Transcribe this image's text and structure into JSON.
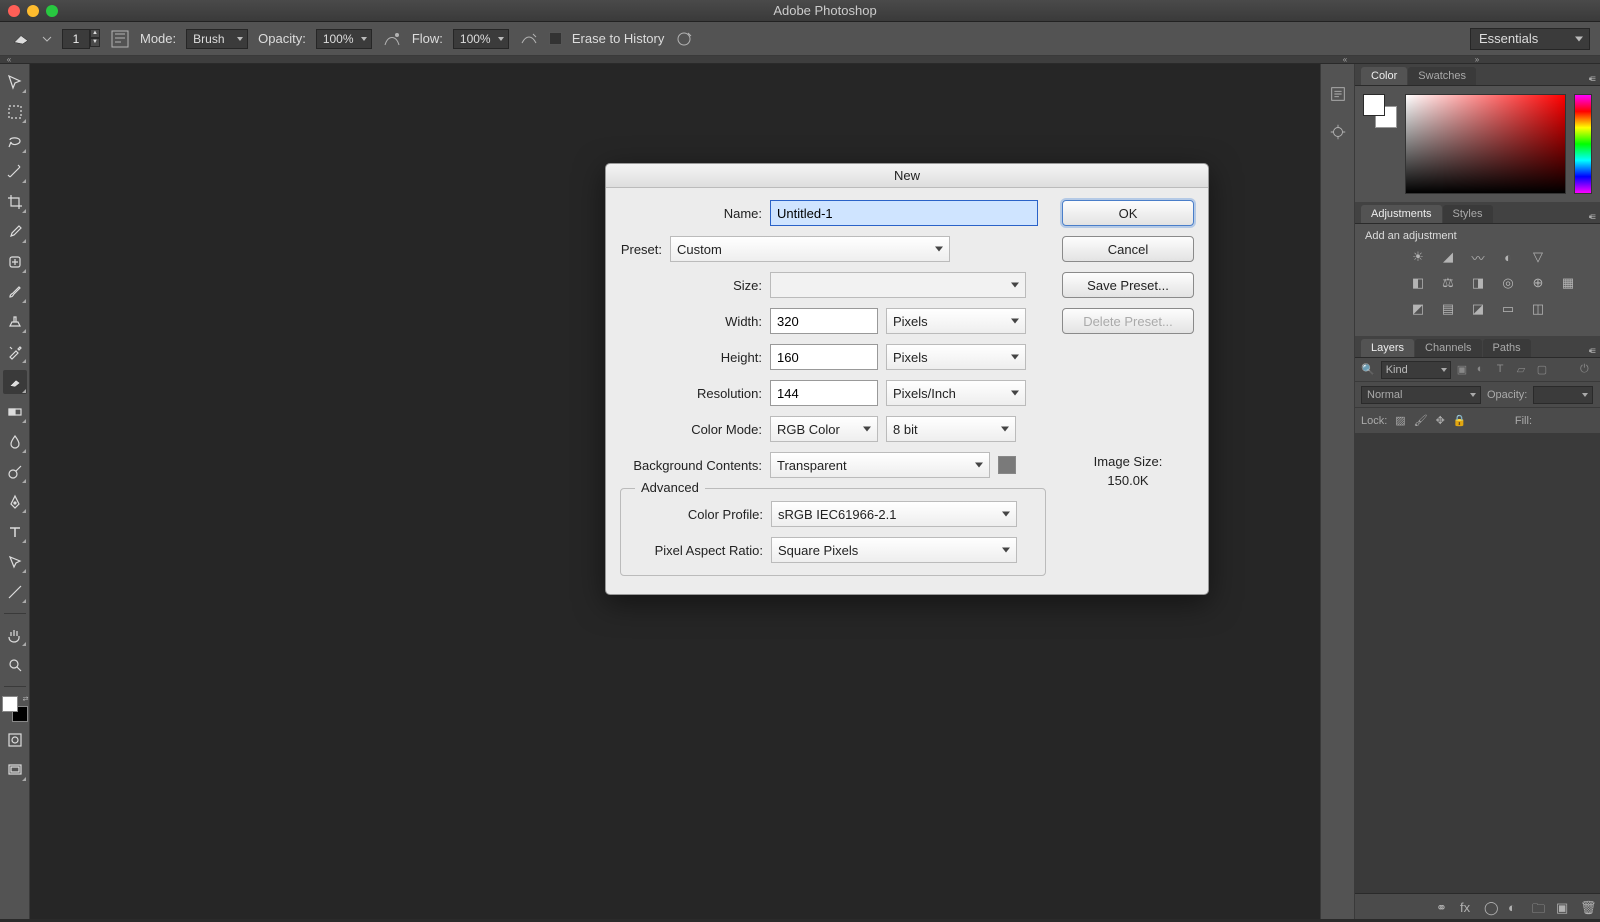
{
  "app": {
    "title": "Adobe Photoshop"
  },
  "optionsBar": {
    "brushSize": "1",
    "modeLabel": "Mode:",
    "modeValue": "Brush",
    "opacityLabel": "Opacity:",
    "opacityValue": "100%",
    "flowLabel": "Flow:",
    "flowValue": "100%",
    "eraseHistoryLabel": "Erase to History",
    "workspace": "Essentials"
  },
  "panels": {
    "color": {
      "tabs": [
        "Color",
        "Swatches"
      ],
      "active": "Color"
    },
    "adjustments": {
      "tabs": [
        "Adjustments",
        "Styles"
      ],
      "active": "Adjustments",
      "hint": "Add an adjustment"
    },
    "layers": {
      "tabs": [
        "Layers",
        "Channels",
        "Paths"
      ],
      "active": "Layers",
      "filterKind": "Kind",
      "blendMode": "Normal",
      "opacityLabel": "Opacity:",
      "lockLabel": "Lock:",
      "fillLabel": "Fill:"
    }
  },
  "dialog": {
    "title": "New",
    "labels": {
      "name": "Name:",
      "preset": "Preset:",
      "size": "Size:",
      "width": "Width:",
      "height": "Height:",
      "resolution": "Resolution:",
      "colorMode": "Color Mode:",
      "bgContents": "Background Contents:",
      "advanced": "Advanced",
      "colorProfile": "Color Profile:",
      "pixelAspect": "Pixel Aspect Ratio:",
      "imageSize": "Image Size:"
    },
    "values": {
      "name": "Untitled-1",
      "preset": "Custom",
      "size": "",
      "width": "320",
      "widthUnit": "Pixels",
      "height": "160",
      "heightUnit": "Pixels",
      "resolution": "144",
      "resolutionUnit": "Pixels/Inch",
      "colorMode": "RGB Color",
      "bitDepth": "8 bit",
      "bgContents": "Transparent",
      "colorProfile": "sRGB IEC61966-2.1",
      "pixelAspect": "Square Pixels",
      "imageSize": "150.0K"
    },
    "buttons": {
      "ok": "OK",
      "cancel": "Cancel",
      "savePreset": "Save Preset...",
      "deletePreset": "Delete Preset..."
    }
  }
}
